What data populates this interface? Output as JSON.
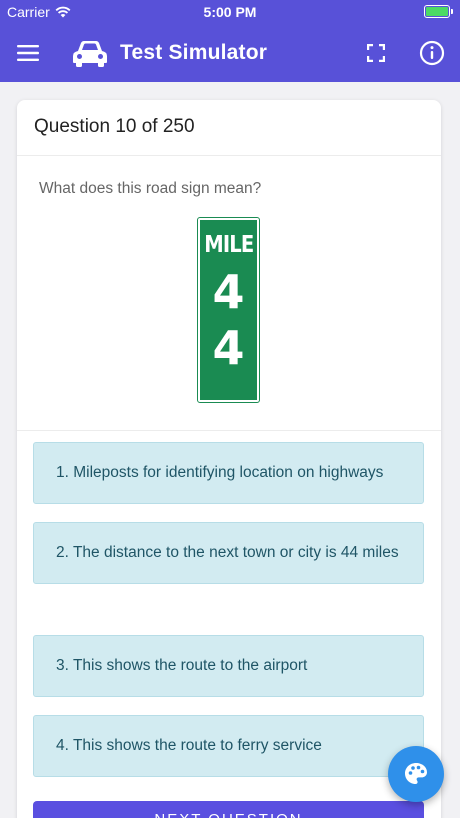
{
  "status_bar": {
    "carrier": "Carrier",
    "time": "5:00 PM",
    "battery_level": 1.0
  },
  "app_bar": {
    "title": "Test Simulator",
    "icons": [
      "menu-icon",
      "car-icon",
      "fullscreen-icon",
      "info-icon"
    ]
  },
  "question": {
    "header": "Question 10 of 250",
    "prompt": "What does this road sign mean?",
    "sign": {
      "line1": "MILE",
      "line2": "4",
      "line3": "4"
    }
  },
  "answers": [
    {
      "label": "1. Mileposts for identifying location on highways"
    },
    {
      "label": "2. The distance to the next town or city is 44 miles"
    },
    {
      "label": "3. This shows the route to the airport"
    },
    {
      "label": "4. This shows the route to ferry service"
    }
  ],
  "next_button": {
    "label": "NEXT QUESTION"
  },
  "fab": {
    "icon": "palette-icon"
  },
  "colors": {
    "primary": "#5851d8",
    "answer_bg": "#d2ebf1",
    "sign_green": "#1a8b52",
    "fab": "#2f90ea"
  }
}
